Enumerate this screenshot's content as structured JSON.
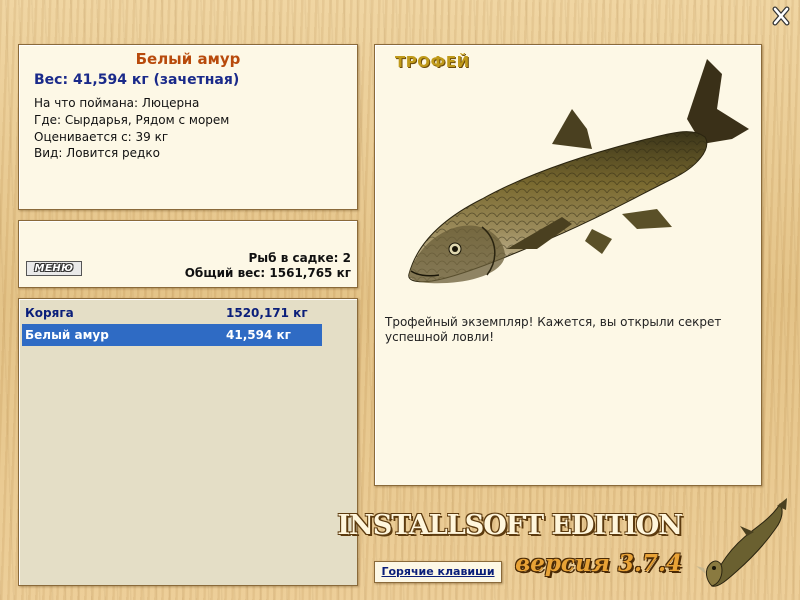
{
  "info": {
    "title": "Белый амур",
    "weight": "Вес: 41,594 кг (зачетная)",
    "bait": "На что поймана: Люцерна",
    "location": "Где: Сырдарья, Рядом с морем",
    "price": "Оценивается с: 39 кг",
    "kind": "Вид: Ловится редко"
  },
  "cage": {
    "menu_label": "МЕНЮ",
    "fish_count": "Рыб в садке: 2",
    "total_weight": "Общий вес: 1561,765 кг"
  },
  "catch_list": {
    "rows": [
      {
        "name": "Коряга",
        "weight": "1520,171 кг",
        "selected": false
      },
      {
        "name": "Белый амур",
        "weight": "41,594 кг",
        "selected": true
      }
    ]
  },
  "trophy": {
    "label": "ТРОФЕЙ",
    "description": "Трофейный экземпляр! Кажется, вы открыли секрет успешной ловли!",
    "image_icon": "grass-carp-fish"
  },
  "footer": {
    "hotkeys_label": "Горячие клавиши",
    "brand_name": "INSTALLSOFT EDITION",
    "version_label": "версия 3.7.4",
    "logo_icon": "pike-fish"
  },
  "window": {
    "close_icon": "close-x"
  },
  "colors": {
    "title": "#b84a0c",
    "weight": "#1a2a8a",
    "list_text": "#0a1e7a",
    "selection": "#2f6bc4",
    "trophy_label": "#c09a1a"
  }
}
